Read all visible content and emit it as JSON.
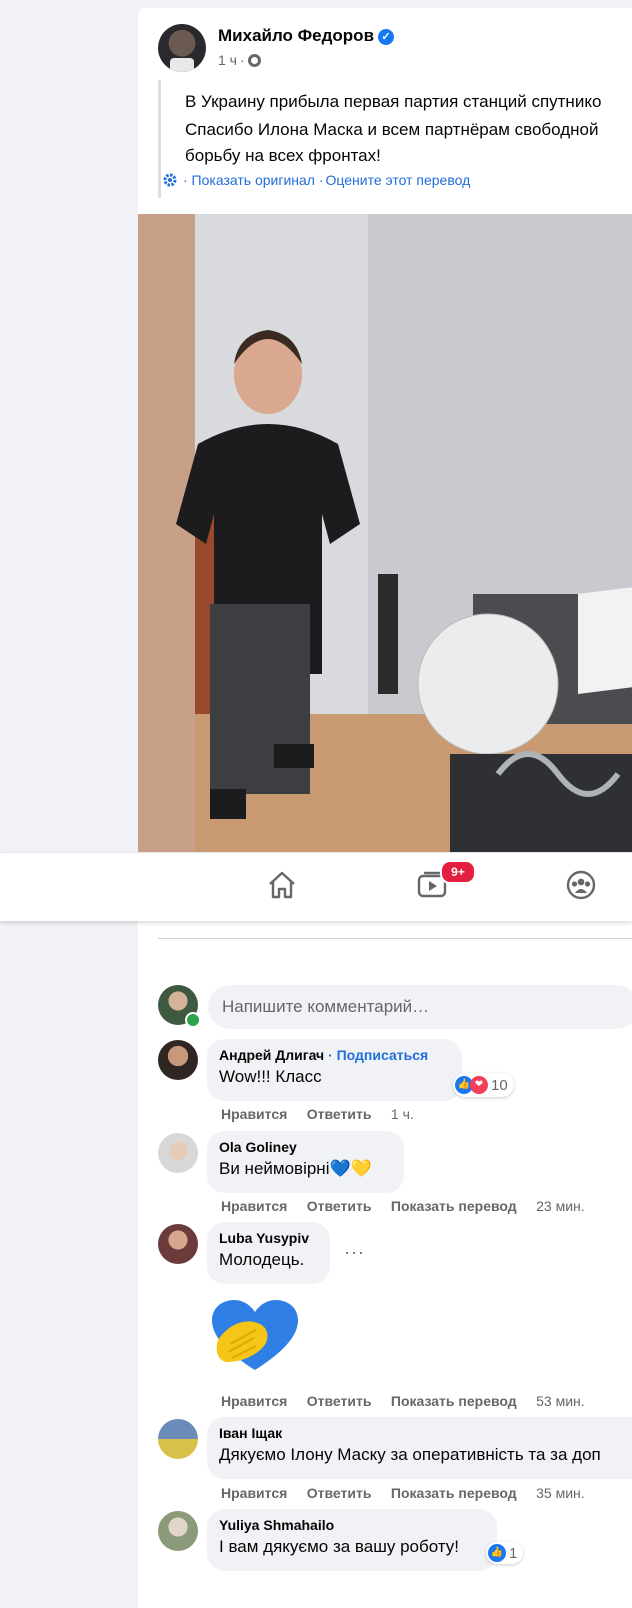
{
  "post": {
    "author": "Михайло Федоров",
    "verified_mark": "✓",
    "time": "1 ч",
    "meta_sep": "·",
    "text_lines": [
      "В Украину прибыла первая партия станций спутнико",
      "Спасибо Илона Маска и всем партнёрам свободной",
      "борьбу на всех фронтах!"
    ],
    "show_original": "· Показать оригинал ·",
    "rate_translation": "Оцените этот перевод"
  },
  "nav": {
    "icons": [
      "home-icon",
      "watch-icon",
      "groups-icon"
    ],
    "watch_badge": "9+"
  },
  "comment_input": {
    "placeholder": "Напишите комментарий…"
  },
  "comments": [
    {
      "name": "Андрей Длигач",
      "follow": "· Подписаться",
      "text": "Wow!!! Класс",
      "like": "Нравится",
      "reply": "Ответить",
      "time": "1 ч.",
      "reaction_count": "10"
    },
    {
      "name": "Ola Goliney",
      "text": "Ви неймовірні💙💛",
      "like": "Нравится",
      "reply": "Ответить",
      "translate": "Показать перевод",
      "time": "23 мин."
    },
    {
      "name": "Luba Yusypiv",
      "text": "Молодець.",
      "dots": "···",
      "sticker_icon": "heart-hands-sticker",
      "like": "Нравится",
      "reply": "Ответить",
      "translate": "Показать перевод",
      "time": "53 мин."
    },
    {
      "name": "Іван Іщак",
      "text": "Дякуємо Ілону Маску за оперативність та за доп",
      "like": "Нравится",
      "reply": "Ответить",
      "translate": "Показать перевод",
      "time": "35 мин."
    },
    {
      "name": "Yuliya Shmahailo",
      "text": "І вам дякуємо за вашу роботу!",
      "reaction_count": "1"
    }
  ],
  "colors": {
    "link": "#216fdb",
    "badge": "#e41e3f",
    "verified": "#1877f2",
    "online": "#31a24c"
  }
}
